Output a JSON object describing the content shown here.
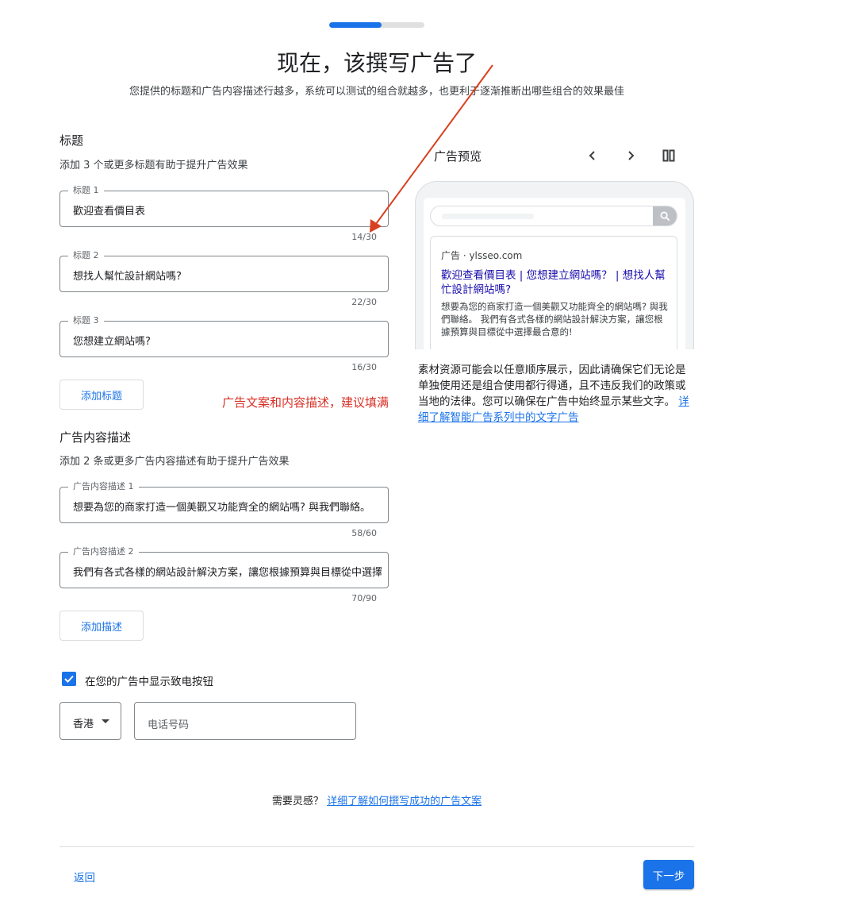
{
  "progress": {
    "fraction": 0.55
  },
  "header": {
    "title": "现在，该撰写广告了",
    "subtitle": "您提供的标题和广告内容描述行越多，系统可以测试的组合就越多，也更利于逐渐推断出哪些组合的效果最佳"
  },
  "headlines": {
    "section_title": "标题",
    "hint": "添加 3 个或更多标题有助于提升广告效果",
    "fields": [
      {
        "label": "标题 1",
        "value": "歡迎查看價目表",
        "counter": "14/30"
      },
      {
        "label": "标题 2",
        "value": "想找人幫忙設計網站嗎?",
        "counter": "22/30"
      },
      {
        "label": "标题 3",
        "value": "您想建立網站嗎?",
        "counter": "16/30"
      }
    ],
    "add_button": "添加标题"
  },
  "annotation": {
    "text": "广告文案和内容描述，建议填满",
    "color": "#d93025"
  },
  "descriptions": {
    "section_title": "广告内容描述",
    "hint": "添加 2 条或更多广告内容描述有助于提升广告效果",
    "fields": [
      {
        "label": "广告内容描述 1",
        "value": "想要為您的商家打造一個美觀又功能齊全的網站嗎? 與我們聯絡。",
        "counter": "58/60"
      },
      {
        "label": "广告内容描述 2",
        "value": "我們有各式各樣的網站設計解決方案，讓您根據預算與目標從中選擇最合意的!",
        "counter": "70/90"
      }
    ],
    "add_button": "添加描述"
  },
  "preview": {
    "title": "广告预览",
    "icons": [
      "chevron-left-icon",
      "chevron-right-icon",
      "split-view-icon",
      "search-icon"
    ],
    "ad": {
      "meta": "广告 · ylsseo.com",
      "headline": "歡迎查看價目表 | 您想建立網站嗎？ | 想找人幫忙設計網站嗎?",
      "description": "想要為您的商家打造一個美觀又功能齊全的網站嗎? 與我們聯絡。 我們有各式各樣的網站設計解決方案，讓您根據預算與目標從中選擇最合意的!"
    },
    "note": "素材资源可能会以任意顺序展示，因此请确保它们无论是单独使用还是组合使用都行得通，且不违反我们的政策或当地的法律。您可以确保在广告中始终显示某些文字。",
    "note_link": "详细了解智能广告系列中的文字广告"
  },
  "call": {
    "checkbox_checked": true,
    "checkbox_label": "在您的广告中显示致电按钮",
    "country": "香港",
    "phone_placeholder": "电话号码"
  },
  "inspiration": {
    "text": "需要灵感？",
    "link": "详细了解如何撰写成功的广告文案"
  },
  "footer": {
    "back": "返回",
    "next": "下一步"
  },
  "colors": {
    "accent": "#1a73e8",
    "ad_headline": "#1a0dab",
    "annotation": "#d93025"
  }
}
